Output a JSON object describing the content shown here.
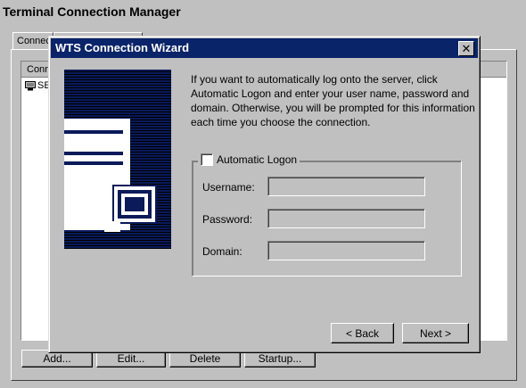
{
  "main": {
    "title": "Terminal Connection Manager",
    "tabs": [
      {
        "label": "Connec"
      },
      {
        "label": ""
      }
    ],
    "list_header": "Conn",
    "list_item": "SE",
    "buttons": {
      "add": "Add...",
      "edit": "Edit...",
      "delete": "Delete",
      "startup": "Startup..."
    }
  },
  "dialog": {
    "title": "WTS Connection Wizard",
    "close_glyph": "✕",
    "intro": "If you want to automatically log onto the server, click Automatic Logon and enter your user name, password and domain. Otherwise, you will be prompted for this information each time you choose the connection.",
    "auto_logon": {
      "label": "Automatic Logon",
      "checked": false
    },
    "fields": {
      "username": {
        "label": "Username:",
        "value": ""
      },
      "password": {
        "label": "Password:",
        "value": ""
      },
      "domain": {
        "label": "Domain:",
        "value": ""
      }
    },
    "buttons": {
      "back": "< Back",
      "next": "Next >"
    }
  },
  "colors": {
    "face": "#c0c0c0",
    "titlebar": "#0a246a",
    "wizard_panel": "#0a1a5a"
  },
  "icons": [
    "computer-icon",
    "close-icon",
    "terminal-wizard-graphic"
  ]
}
